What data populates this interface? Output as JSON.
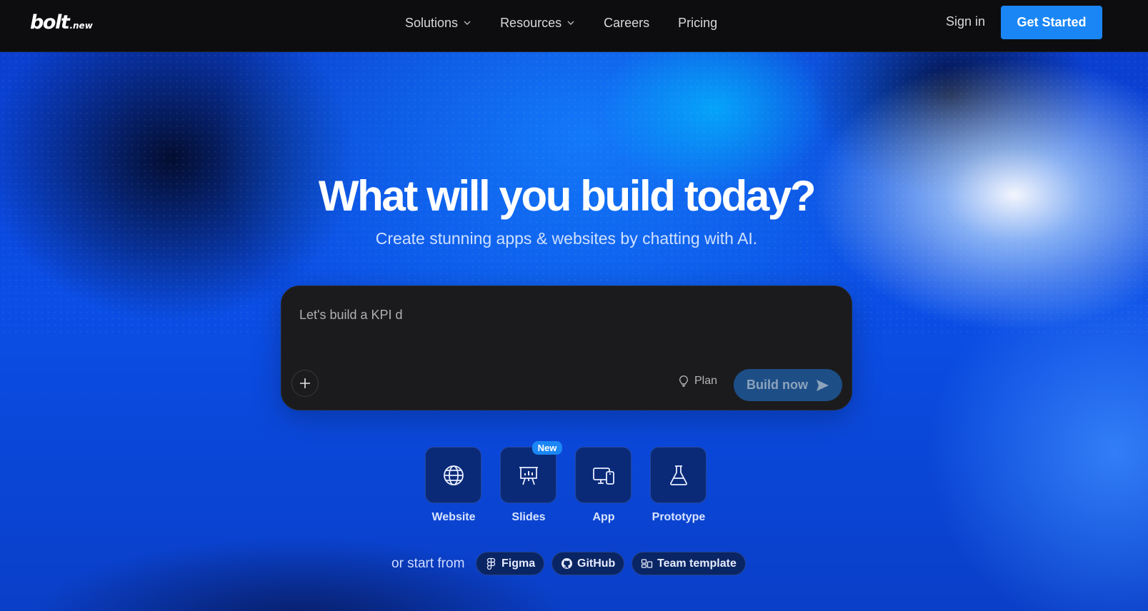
{
  "nav": {
    "logo_main": "bolt",
    "logo_suffix": ".new",
    "links": [
      {
        "label": "Solutions",
        "dropdown": true
      },
      {
        "label": "Resources",
        "dropdown": true
      },
      {
        "label": "Careers",
        "dropdown": false
      },
      {
        "label": "Pricing",
        "dropdown": false
      }
    ],
    "sign_in": "Sign in",
    "get_started": "Get Started"
  },
  "hero": {
    "title": "What will you build today?",
    "subtitle": "Create stunning apps & websites by chatting with AI."
  },
  "prompt": {
    "value": "Let's build a KPI d",
    "plan_label": "Plan",
    "build_label": "Build now"
  },
  "categories": [
    {
      "label": "Website",
      "icon": "globe-icon"
    },
    {
      "label": "Slides",
      "icon": "presentation-icon",
      "badge": "New"
    },
    {
      "label": "App",
      "icon": "devices-icon"
    },
    {
      "label": "Prototype",
      "icon": "flask-icon"
    }
  ],
  "start_from": {
    "label": "or start from",
    "options": [
      {
        "label": "Figma",
        "icon": "figma-icon"
      },
      {
        "label": "GitHub",
        "icon": "github-icon"
      },
      {
        "label": "Team template",
        "icon": "template-icon"
      }
    ]
  },
  "colors": {
    "accent": "#1a86f5",
    "nav_bg": "#0d0d0f",
    "prompt_bg": "#1b1b1d",
    "build_btn_bg": "#1d4e86"
  }
}
